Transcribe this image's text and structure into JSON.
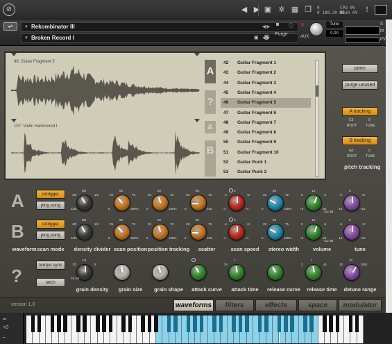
{
  "host": {
    "stats": [
      "0",
      "0 180.30 MB",
      "CPU 0%",
      "Disk 0%"
    ],
    "icons": [
      "logo-icon",
      "left-arrow-icon",
      "right-arrow-icon",
      "save-icon",
      "gear-icon",
      "grid-icon",
      "window-icon",
      "info-icon",
      "panel-icon"
    ]
  },
  "instrument": {
    "name": "Rekombinator III",
    "snapshot": "Broken Record I",
    "purge_label": "Purge",
    "tune_label": "Tune",
    "tune_value": "0.00",
    "s_label": "S",
    "m_label": "M",
    "aux_label": "AUX",
    "pv_label": "PV"
  },
  "display": {
    "wave_a_label": "46: Guitar Fragment 5",
    "wave_b_label": "107: Violin Hammered I",
    "slots": [
      "A",
      "?",
      "&",
      "B"
    ],
    "active_slot": 0,
    "list": [
      {
        "num": "42",
        "name": "Guitar Fragment 1"
      },
      {
        "num": "43",
        "name": "Guitar Fragment 2"
      },
      {
        "num": "44",
        "name": "Guitar Fragment 3"
      },
      {
        "num": "45",
        "name": "Guitar Fragment 4"
      },
      {
        "num": "46",
        "name": "Guitar Fragment 5"
      },
      {
        "num": "47",
        "name": "Guitar Fragment 6"
      },
      {
        "num": "48",
        "name": "Guitar Fragment 7"
      },
      {
        "num": "49",
        "name": "Guitar Fragment 8"
      },
      {
        "num": "50",
        "name": "Guitar Fragment 9"
      },
      {
        "num": "51",
        "name": "Guitar Fragment 10"
      },
      {
        "num": "52",
        "name": "Guitar Punk 1"
      },
      {
        "num": "53",
        "name": "Guitar Punk 2"
      }
    ],
    "selected_index": 4
  },
  "side": {
    "panic": "panic",
    "purge_unused": "purge unused",
    "a_tracking": "A tracking",
    "a_root": "C3",
    "a_tune": "0",
    "b_tracking": "B tracking",
    "b_root": "G2",
    "b_tune": "0",
    "root_label": "ROOT",
    "tune_label": "TUNE",
    "pitch_tracking": "pitch tracking"
  },
  "rows": {
    "a_letter": "A",
    "b_letter": "B",
    "q_letter": "?",
    "retrigger": "retrigger",
    "ping_pong": "ping pong",
    "tempo_sync": "tempo sync",
    "latch": "latch"
  },
  "knob_scales": {
    "density": [
      "8th",
      "4th",
      "1/2",
      "1/32"
    ],
    "pos": [
      "50",
      "25",
      "75",
      "0",
      "100%"
    ],
    "track": [
      "50",
      "25",
      "75",
      "0",
      "100%"
    ],
    "scatter": [
      "50",
      "25",
      "75",
      "0",
      "100"
    ],
    "speed": [
      "0",
      "-2",
      "+2",
      "-4",
      "+4"
    ],
    "width": [
      "50",
      "25",
      "75",
      "0",
      "100%"
    ],
    "volume": [
      "-12",
      "0",
      "-6",
      "+6",
      "-24",
      "+12 dB"
    ],
    "tune": [
      "0",
      "-6",
      "+6",
      "-12",
      "+12"
    ],
    "gdens": [
      "1/4",
      "1/2",
      "8",
      "16 ms"
    ],
    "gsize": [],
    "gshape": [],
    "attack": [],
    "atime": [
      "1",
      "2s"
    ],
    "rcurve": [],
    "rtime": [
      "1",
      "2",
      "4s"
    ],
    "drange": [
      "20",
      "10",
      "50ct"
    ]
  },
  "labels": {
    "waveform": "waveform",
    "scan_mode": "scan mode",
    "density_divider": "density divider",
    "scan_position": "scan position",
    "position_tracking": "position tracking",
    "scatter": "scatter",
    "scan_speed": "scan speed",
    "stereo_width": "stereo width",
    "volume": "volume",
    "tune": "tune",
    "grain_density": "grain density",
    "grain_size": "grain size",
    "grain_shape": "grain shape",
    "attack_curve": "attack curve",
    "attack_time": "attack time",
    "release_curve": "release curve",
    "release_time": "release time",
    "detune_range": "detune range"
  },
  "footer": {
    "version": "version 1.0",
    "tabs": [
      "waveforms",
      "filters",
      "effects",
      "space",
      "modulator"
    ],
    "active_tab": 0
  },
  "keyboard": {
    "octave": "+0",
    "highlight_start_white": 20,
    "highlight_end_white": 45
  },
  "colors": {
    "accent_orange": "#e89c26",
    "display_bg": "#cfccb8",
    "key_highlight": "#8ad3ec",
    "knob_brown": "#c9771e",
    "knob_red": "#c22a1c",
    "knob_teal": "#1d8db0",
    "knob_green": "#2f8a2a",
    "knob_purple": "#8a4aa8"
  }
}
